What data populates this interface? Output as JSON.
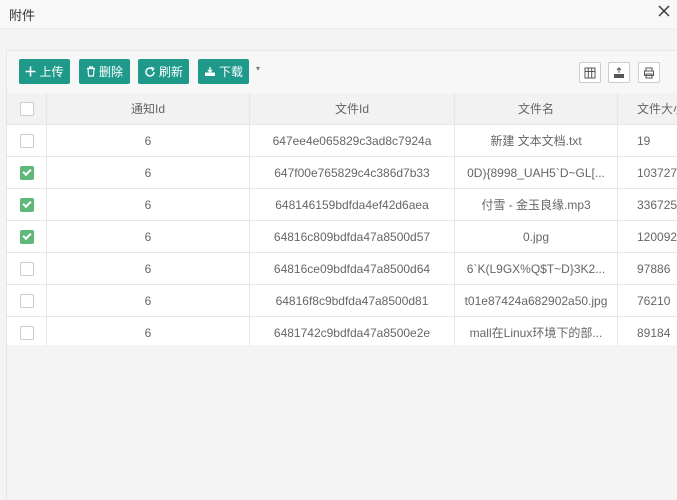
{
  "window": {
    "title": "附件"
  },
  "toolbar": {
    "upload_label": "上传",
    "delete_label": "删除",
    "refresh_label": "刷新",
    "download_label": "下载",
    "dropdown_caret": "▾"
  },
  "table": {
    "columns": [
      "通知Id",
      "文件Id",
      "文件名",
      "文件大小"
    ],
    "rows": [
      {
        "checked": false,
        "notice_id": "6",
        "file_id": "647ee4e065829c3ad8c7924a",
        "file_name": "新建 文本文档.txt",
        "file_size": "19"
      },
      {
        "checked": true,
        "notice_id": "6",
        "file_id": "647f00e765829c4c386d7b33",
        "file_name": "0D){8998_UAH5`D~GL[...",
        "file_size": "103727"
      },
      {
        "checked": true,
        "notice_id": "6",
        "file_id": "648146159bdfda4ef42d6aea",
        "file_name": "付雪 - 金玉良缘.mp3",
        "file_size": "336725"
      },
      {
        "checked": true,
        "notice_id": "6",
        "file_id": "64816c809bdfda47a8500d57",
        "file_name": "0.jpg",
        "file_size": "120092"
      },
      {
        "checked": false,
        "notice_id": "6",
        "file_id": "64816ce09bdfda47a8500d64",
        "file_name": "6`K(L9GX%Q$T~D}3K2...",
        "file_size": "97886"
      },
      {
        "checked": false,
        "notice_id": "6",
        "file_id": "64816f8c9bdfda47a8500d81",
        "file_name": "t01e87424a682902a50.jpg",
        "file_size": "76210"
      },
      {
        "checked": false,
        "notice_id": "6",
        "file_id": "6481742c9bdfda47a8500e2e",
        "file_name": "mall在Linux环境下的部...",
        "file_size": "89184"
      }
    ]
  },
  "colors": {
    "accent": "#1f9a8a",
    "checkbox_on": "#5fb878"
  }
}
